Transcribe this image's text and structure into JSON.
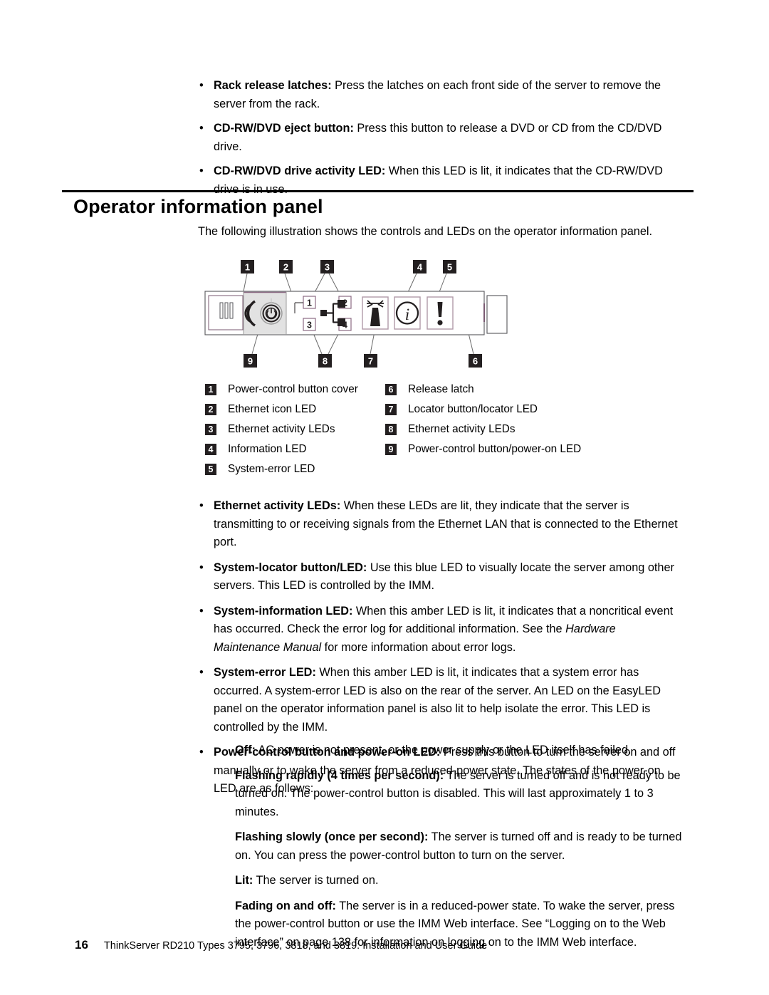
{
  "document": {
    "heading": "Operator information panel",
    "intro": "The following illustration shows the controls and LEDs on the operator information panel.",
    "footer": {
      "page_number": "16",
      "text": "ThinkServer RD210 Types 3795, 3796, 3818, and 3819:  Installation and User Guide"
    }
  },
  "top_bullets": [
    {
      "bullet": "•",
      "term": "Rack release latches:",
      "text": " Press the latches on each front side of the server to remove the server from the rack."
    },
    {
      "bullet": "•",
      "term": "CD-RW/DVD eject button:",
      "text": " Press this button to release a DVD or CD from the CD/DVD drive."
    },
    {
      "bullet": "•",
      "term": "CD-RW/DVD drive activity LED:",
      "text": " When this LED is lit, it indicates that the CD-RW/DVD drive is in use."
    }
  ],
  "figure": {
    "callouts_top": [
      "1",
      "2",
      "3",
      "4",
      "5"
    ],
    "callouts_bottom": [
      "9",
      "8",
      "7",
      "6"
    ],
    "inline_labels": [
      "1",
      "2",
      "3",
      "4"
    ],
    "icons": [
      "cd-dvd-drive-icon",
      "power-control-button-icon",
      "ethernet-icon",
      "locator-beacon-icon",
      "information-icon",
      "system-error-icon",
      "release-latch-icon"
    ]
  },
  "legend": {
    "left": [
      {
        "num": "1",
        "label": "Power-control button cover"
      },
      {
        "num": "2",
        "label": "Ethernet icon LED"
      },
      {
        "num": "3",
        "label": "Ethernet activity LEDs"
      },
      {
        "num": "4",
        "label": "Information LED"
      },
      {
        "num": "5",
        "label": "System-error LED"
      }
    ],
    "right": [
      {
        "num": "6",
        "label": "Release latch"
      },
      {
        "num": "7",
        "label": "Locator button/locator LED"
      },
      {
        "num": "8",
        "label": "Ethernet activity LEDs"
      },
      {
        "num": "9",
        "label": "Power-control button/power-on LED"
      }
    ]
  },
  "main_bullets": [
    {
      "bullet": "•",
      "term": "Ethernet activity LEDs:",
      "text": " When these LEDs are lit, they indicate that the server is transmitting to or receiving signals from the Ethernet LAN that is connected to the Ethernet port."
    },
    {
      "bullet": "•",
      "term": "System-locator button/LED:",
      "text": " Use this blue LED to visually locate the server among other servers. This LED is controlled by the IMM."
    },
    {
      "bullet": "•",
      "term": "System-information LED:",
      "text_before": " When this amber LED is lit, it indicates that a noncritical event has occurred. Check the error log for additional information. See the ",
      "italic": "Hardware Maintenance Manual",
      "text_after": " for more information about error logs."
    },
    {
      "bullet": "•",
      "term": "System-error LED:",
      "text": " When this amber LED is lit, it indicates that a system error has occurred. A system-error LED is also on the rear of the server. An LED on the EasyLED panel on the operator information panel is also lit to help isolate the error. This LED is controlled by the IMM."
    },
    {
      "bullet": "•",
      "term": "Power-control button and power-on LED:",
      "text": " Press this button to turn the server on and off manually or to wake the server from a reduced-power state. The states of the power-on LED are as follows:"
    }
  ],
  "states": [
    {
      "term": "Off:",
      "text": " AC power is not present, or the power supply or the LED itself has failed."
    },
    {
      "term": "Flashing rapidly (4 times per second):",
      "text": " The server is turned off and is not ready to be turned on. The power-control button is disabled. This will last approximately 1 to 3 minutes."
    },
    {
      "term": "Flashing slowly (once per second):",
      "text": " The server is turned off and is ready to be turned on. You can press the power-control button to turn on the server."
    },
    {
      "term": "Lit:",
      "text": " The server is turned on."
    },
    {
      "term": "Fading on and off:",
      "text": " The server is in a reduced-power state. To wake the server, press the power-control button or use the IMM Web interface. See “Logging on to the Web interface” on page 138 for information on logging on to the IMM Web interface."
    }
  ],
  "colors": {
    "text": "#000000",
    "badge_bg": "#231f20",
    "badge_fg": "#ffffff",
    "panel_stroke": "#231f20",
    "panel_shade": "#e2e2e2",
    "accent_line": "#8b6b84"
  }
}
